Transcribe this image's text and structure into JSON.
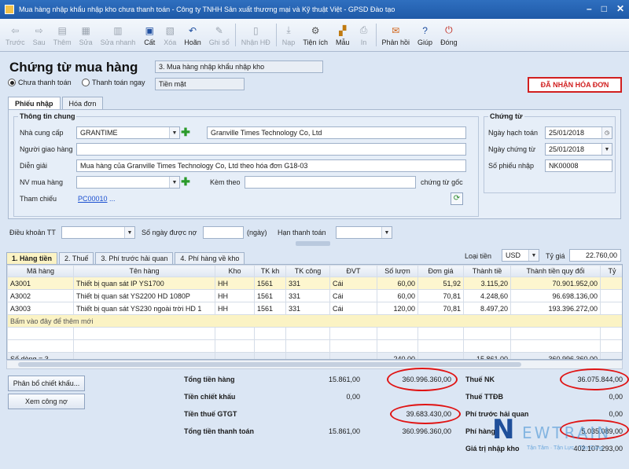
{
  "window": {
    "title": "Mua hàng nhập khẩu nhập kho chưa thanh toán - Công ty TNHH Sản xuất thương mại và Kỹ thuật Việt - GPSD Đào tạo"
  },
  "toolbar": {
    "prev": "Trước",
    "next": "Sau",
    "add": "Thêm",
    "edit": "Sửa",
    "quick_edit": "Sửa nhanh",
    "save": "Cất",
    "delete": "Xóa",
    "undo": "Hoãn",
    "record": "Ghi sổ",
    "receive_invoice": "Nhận HĐ",
    "import": "Nạp",
    "utilities": "Tiện ích",
    "template": "Mẫu",
    "print": "In",
    "feedback": "Phản hồi",
    "help": "Giúp",
    "close": "Đóng"
  },
  "header": {
    "doc_title": "Chứng từ mua hàng",
    "doc_type": "3. Mua hàng nhập khẩu nhập kho",
    "radio_unpaid": "Chưa thanh toán",
    "radio_paid": "Thanh toán ngay",
    "payment_method": "Tiền mặt",
    "invoice_received": "ĐÃ NHẬN HÓA ĐƠN"
  },
  "tabs": {
    "receipt": "Phiếu nhập",
    "invoice": "Hóa đơn"
  },
  "general": {
    "legend": "Thông tin chung",
    "supplier_label": "Nhà cung cấp",
    "supplier_code": "GRANTIME",
    "supplier_name": "Granville Times Technology Co, Ltd",
    "deliverer_label": "Người giao hàng",
    "deliverer_value": "",
    "desc_label": "Diễn giải",
    "desc_value": "Mua hàng của Granville Times Technology Co, Ltd theo hóa đơn G18-03",
    "buyer_label": "NV mua hàng",
    "buyer_value": "",
    "attach_label": "Kèm theo",
    "attach_value": "",
    "attach_suffix": "chứng từ gốc",
    "ref_label": "Tham chiếu",
    "ref_link": "PC00010",
    "ref_more": "..."
  },
  "voucher": {
    "legend": "Chứng từ",
    "posting_date_label": "Ngày hạch toán",
    "posting_date": "25/01/2018",
    "doc_date_label": "Ngày chứng từ",
    "doc_date": "25/01/2018",
    "receipt_no_label": "Số phiếu nhập",
    "receipt_no": "NK00008"
  },
  "terms": {
    "payment_terms_label": "Điều khoản TT",
    "payment_terms_value": "",
    "credit_days_label": "Số ngày được nợ",
    "credit_days_value": "",
    "days_unit": "(ngày)",
    "due_date_label": "Hạn thanh toán",
    "due_date_value": ""
  },
  "detail_tabs": [
    "1. Hàng tiền",
    "2. Thuế",
    "3. Phí trước hải quan",
    "4. Phí hàng về kho"
  ],
  "currency": {
    "label": "Loại tiền",
    "value": "USD",
    "rate_label": "Tỷ giá",
    "rate_value": "22.760,00"
  },
  "grid": {
    "columns": [
      "Mã hàng",
      "Tên hàng",
      "Kho",
      "TK kh",
      "TK công",
      "ĐVT",
      "Số lượn",
      "Đơn giá",
      "Thành tiề",
      "Thành tiền quy đổi",
      "Tỷ"
    ],
    "rows": [
      {
        "code": "A3001",
        "name": "Thiết bị quan sát IP YS1700",
        "warehouse": "HH",
        "debit": "1561",
        "credit": "331",
        "unit": "Cái",
        "qty": "60,00",
        "price": "51,92",
        "amount": "3.115,20",
        "amount_vnd": "70.901.952,00"
      },
      {
        "code": "A3002",
        "name": "Thiết bị quan sát YS2200 HD 1080P",
        "warehouse": "HH",
        "debit": "1561",
        "credit": "331",
        "unit": "Cái",
        "qty": "60,00",
        "price": "70,81",
        "amount": "4.248,60",
        "amount_vnd": "96.698.136,00"
      },
      {
        "code": "A3003",
        "name": "Thiết bị quan sát YS230 ngoài trời HD 1",
        "warehouse": "HH",
        "debit": "1561",
        "credit": "331",
        "unit": "Cái",
        "qty": "120,00",
        "price": "70,81",
        "amount": "8.497,20",
        "amount_vnd": "193.396.272,00"
      }
    ],
    "add_row_text": "Bấm vào đây để thêm mới",
    "row_count": "Số dòng = 3",
    "total_qty": "240,00",
    "total_amount": "15.861,00",
    "total_amount_vnd": "360.996.360,00"
  },
  "buttons": {
    "allocate_discount": "Phân bổ chiết khấu...",
    "view_debt": "Xem công nợ"
  },
  "totals": {
    "goods_label": "Tổng tiền hàng",
    "goods_fc": "15.861,00",
    "goods_vnd": "360.996.360,00",
    "discount_label": "Tiền chiết khấu",
    "discount_fc": "0,00",
    "vat_label": "Tiền thuế GTGT",
    "vat_vnd": "39.683.430,00",
    "payment_label": "Tổng tiền thanh toán",
    "payment_fc": "15.861,00",
    "payment_vnd": "360.996.360,00",
    "import_tax_label": "Thuế NK",
    "import_tax": "36.075.844,00",
    "excise_label": "Thuế TTĐB",
    "excise": "0,00",
    "pre_customs_label": "Phí trước hải quan",
    "pre_customs": "0,00",
    "fee_label": "Phí hàng",
    "fee": "5.035.089,00",
    "import_value_label": "Giá trị nhập kho",
    "import_value": "402.107.293,00"
  },
  "watermark": {
    "first": "N",
    "rest": "EWTRAIN",
    "slogan": "Tận Tâm · Tận Lực · Tận Cùng"
  },
  "colors": {
    "title_bar": "#2f6fbf",
    "highlight_ring": "#e01414",
    "invoice_badge": "#d11f1f",
    "link": "#1a4fd0",
    "selected_row": "#fdf6cf"
  }
}
